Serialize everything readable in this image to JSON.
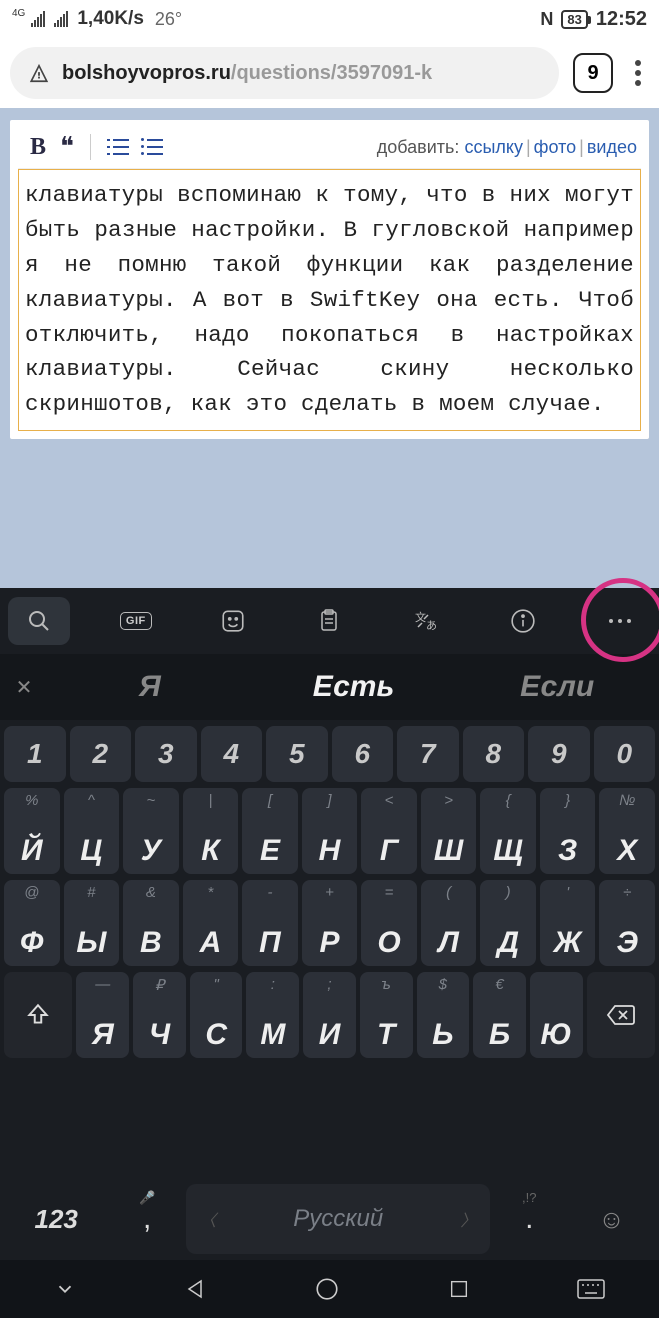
{
  "status": {
    "sig1_label": "4G",
    "speed": "1,40K/s",
    "temp": "26°",
    "nfc": "N",
    "battery": "83",
    "time": "12:52"
  },
  "browser": {
    "url_host": "bolshoyvopros.ru",
    "url_path": "/questions/3597091-k",
    "tab_count": "9"
  },
  "editor": {
    "bold": "B",
    "quote": "❝",
    "add_label": "добавить:",
    "link": "ссылку",
    "photo": "фото",
    "video": "видео",
    "text": "клавиатуры вспоминаю к тому, что в них могут быть разные настройки. В гугловской например я не помню такой функции как разделение клавиатуры. А вот в SwiftKey она есть. Чтоб отключить, надо покопаться в настройках клавиатуры. Сейчас скину несколько скриншотов, как это сделать в моем случае."
  },
  "keyboard": {
    "toolbar": {
      "gif": "GIF"
    },
    "suggestions": {
      "s1": "Я",
      "s2": "Есть",
      "s3": "Если"
    },
    "num_row": [
      "1",
      "2",
      "3",
      "4",
      "5",
      "6",
      "7",
      "8",
      "9",
      "0"
    ],
    "row1_alt": [
      "%",
      "^",
      "~",
      "|",
      "[",
      "]",
      "<",
      ">",
      "{",
      "}",
      "№"
    ],
    "row1": [
      "Й",
      "Ц",
      "У",
      "К",
      "Е",
      "Н",
      "Г",
      "Ш",
      "Щ",
      "З",
      "Х"
    ],
    "row2_alt": [
      "@",
      "#",
      "&",
      "*",
      "-",
      "+",
      "=",
      "(",
      ")",
      "'",
      "÷"
    ],
    "row2": [
      "Ф",
      "Ы",
      "В",
      "А",
      "П",
      "Р",
      "О",
      "Л",
      "Д",
      "Ж",
      "Э"
    ],
    "row3_alt": [
      "—",
      "₽",
      "\"",
      ":",
      ";",
      "ъ",
      "$",
      "€"
    ],
    "row3": [
      "Я",
      "Ч",
      "С",
      "М",
      "И",
      "Т",
      "Ь",
      "Б",
      "Ю"
    ],
    "bottom": {
      "mode": "123",
      "comma": ",",
      "space": "Русский",
      "dot": ".",
      "dot_hint": ",!?"
    }
  }
}
